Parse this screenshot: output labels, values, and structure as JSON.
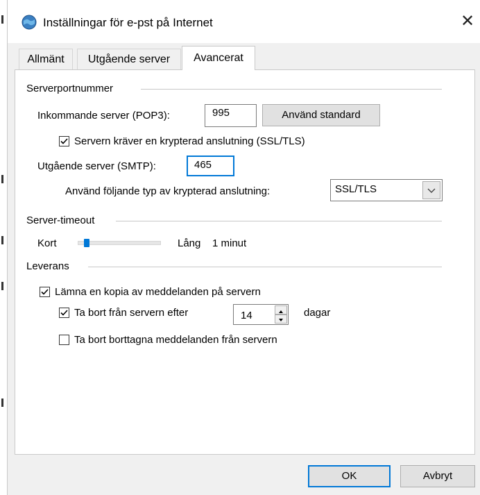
{
  "window": {
    "title": "Inställningar för e-pst på Internet"
  },
  "tabs": [
    {
      "label": "Allmänt",
      "active": false
    },
    {
      "label": "Utgående server",
      "active": false
    },
    {
      "label": "Avancerat",
      "active": true
    }
  ],
  "server_ports": {
    "group_label": "Serverportnummer",
    "incoming_label": "Inkommande server (POP3):",
    "incoming_value": "995",
    "use_default_label": "Använd standard",
    "ssl_checkbox_label": "Servern kräver en krypterad anslutning (SSL/TLS)",
    "ssl_checked": true,
    "outgoing_label": "Utgående server (SMTP):",
    "outgoing_value": "465",
    "encryption_label": "Använd följande typ av krypterad anslutning:",
    "encryption_value": "SSL/TLS"
  },
  "timeout": {
    "group_label": "Server-timeout",
    "short_label": "Kort",
    "long_label": "Lång",
    "value_label": "1 minut",
    "level_fraction": 0.1
  },
  "delivery": {
    "group_label": "Leverans",
    "leave_copy_label": "Lämna en kopia av meddelanden på servern",
    "leave_copy_checked": true,
    "remove_after_label": "Ta bort från servern efter",
    "remove_after_checked": true,
    "days_value": "14",
    "days_unit": "dagar",
    "remove_deleted_label": "Ta bort borttagna meddelanden från servern",
    "remove_deleted_checked": false
  },
  "buttons": {
    "ok": "OK",
    "cancel": "Avbryt"
  },
  "colors": {
    "accent": "#0078d7",
    "panel": "#ffffff",
    "dialog": "#f0f0f0"
  }
}
